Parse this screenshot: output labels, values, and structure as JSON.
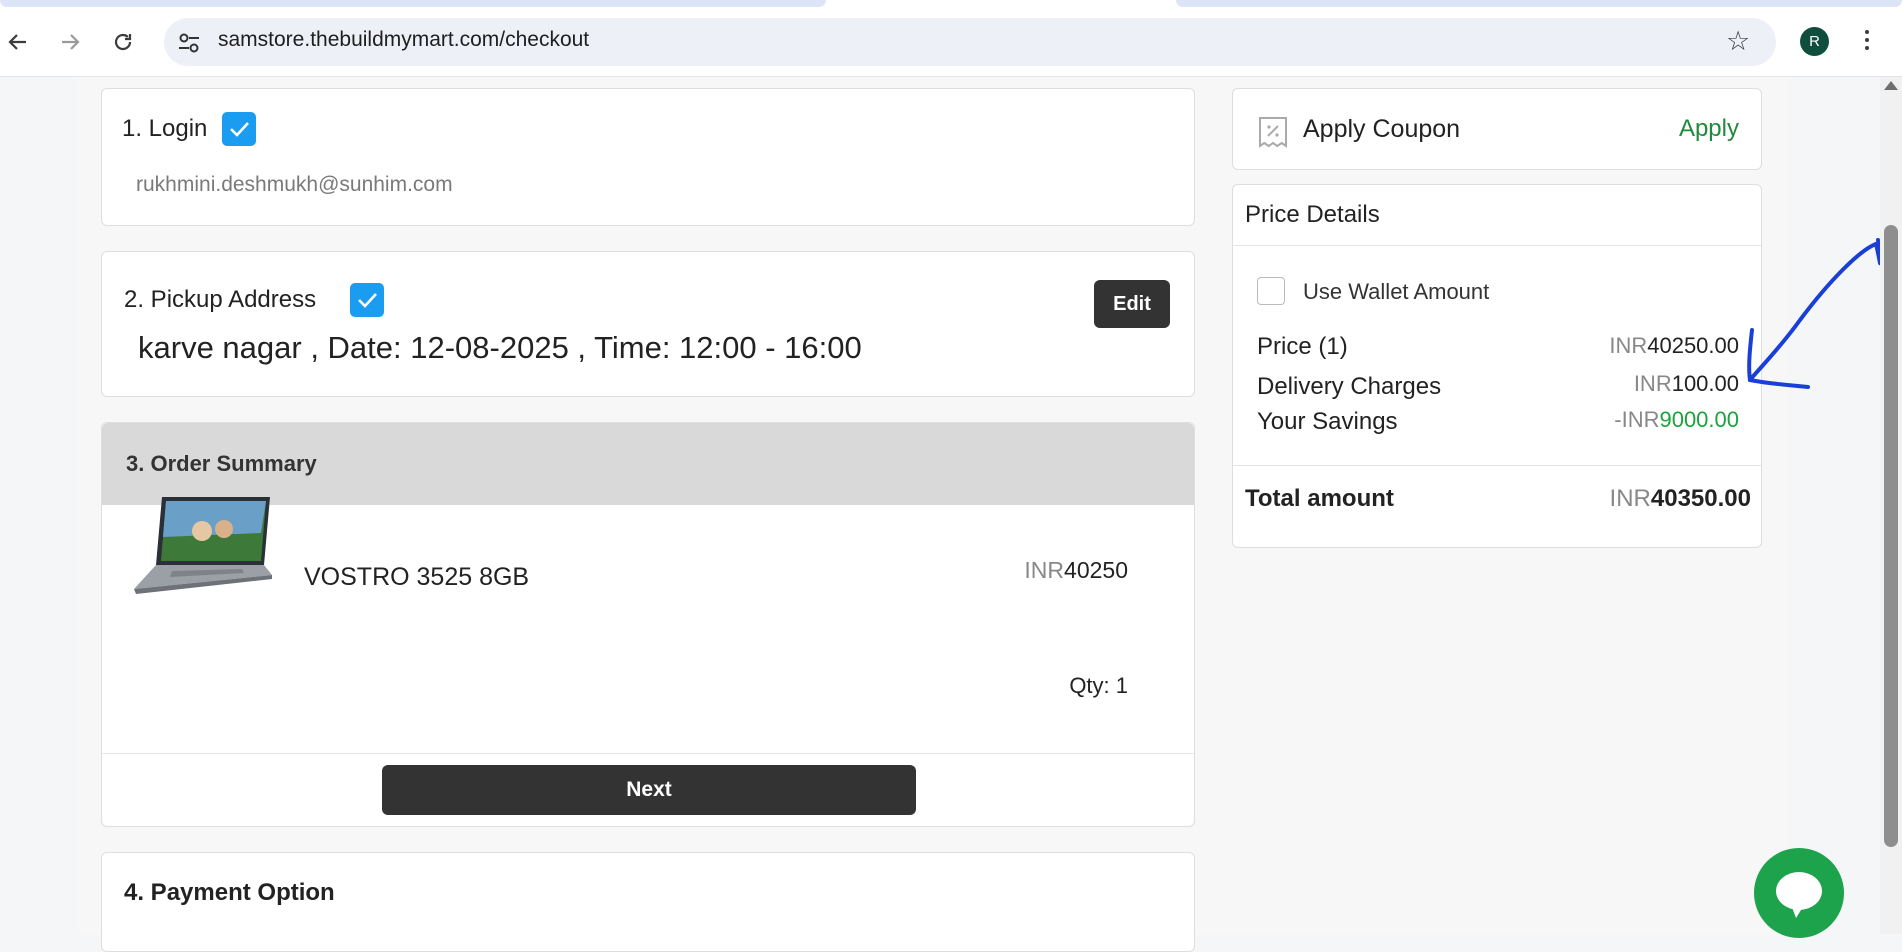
{
  "browser": {
    "url": "samstore.thebuildmymart.com/checkout",
    "avatar_letter": "R",
    "icons": [
      "back-icon",
      "forward-icon",
      "reload-icon",
      "site-settings-icon",
      "bookmark-star-icon",
      "kebab-menu-icon"
    ]
  },
  "login": {
    "title": "1. Login",
    "email": "rukhmini.deshmukh@sunhim.com"
  },
  "pickup": {
    "title": "2. Pickup Address",
    "address": "karve nagar , Date: 12-08-2025 , Time: 12:00 - 16:00",
    "edit_label": "Edit"
  },
  "order": {
    "title": "3. Order Summary",
    "product_name": "VOSTRO 3525 8GB",
    "currency": "INR",
    "price": "40250",
    "qty": "Qty: 1",
    "next_label": "Next"
  },
  "payment": {
    "title": "4. Payment Option"
  },
  "coupon": {
    "title": "Apply Coupon",
    "apply_label": "Apply"
  },
  "price_details": {
    "title": "Price Details",
    "wallet_label": "Use Wallet Amount",
    "price_label": "Price (1)",
    "price_currency": "INR",
    "price_value": "40250.00",
    "delivery_label": "Delivery Charges",
    "delivery_currency": "INR",
    "delivery_value": "100.00",
    "savings_label": "Your Savings",
    "savings_currency": "-INR",
    "savings_value": "9000.00",
    "total_label": "Total amount",
    "total_currency": "INR",
    "total_value": "40350.00"
  },
  "colors": {
    "check_blue": "#1a9cf0",
    "dark_button": "#333333",
    "apply_green": "#208a3c",
    "savings_green": "#1aa33d",
    "chat_green": "#1ea34d",
    "annotation_blue": "#1a3fd6"
  }
}
